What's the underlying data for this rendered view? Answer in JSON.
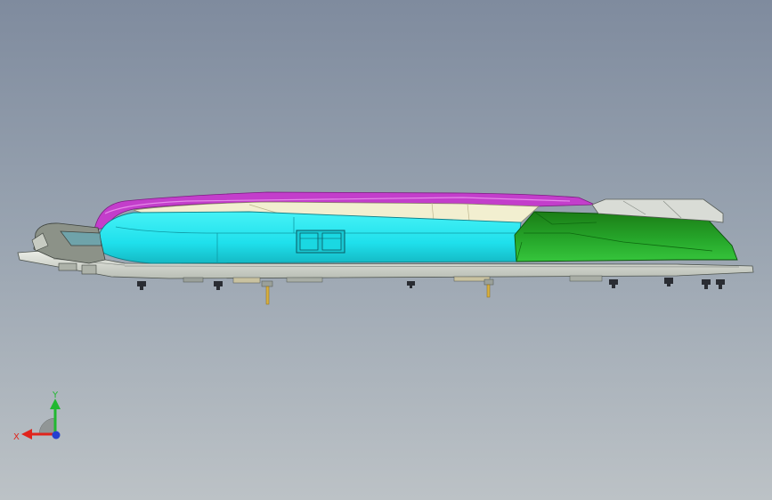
{
  "viewport": {
    "background_top": "#7f8b9e",
    "background_bottom": "#bcc2c6"
  },
  "model": {
    "colors": {
      "body_cyan": "#1fe0ec",
      "body_cyan_dark": "#14b9c4",
      "cover_green": "#1d9a1d",
      "cover_green_dark": "#0e6a10",
      "rim_magenta": "#c33ecb",
      "rim_magenta_light": "#e58ae9",
      "lid_cream": "#f2efd0",
      "base_grey": "#d9dcd6",
      "nose_grey": "#8c9288",
      "pin_gold": "#d8b040"
    }
  },
  "triad": {
    "x_label": "X",
    "y_label": "Y",
    "x_color": "#e0241c",
    "y_color": "#21b830",
    "z_color": "#2440d0"
  }
}
